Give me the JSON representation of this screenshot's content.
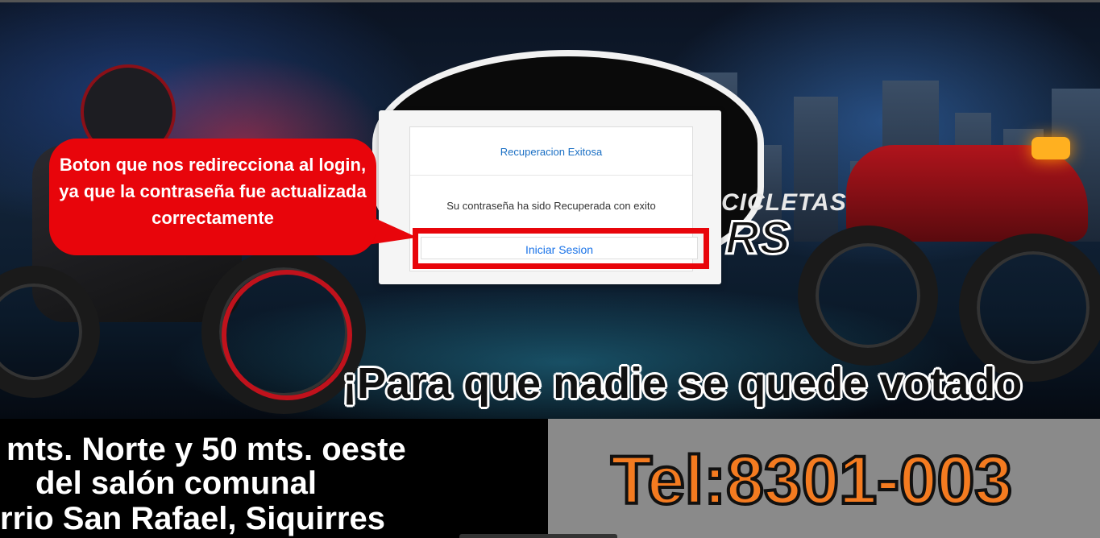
{
  "background": {
    "slogan": "¡Para que nadie se quede votado",
    "brand_partial_1": "CICLETAS",
    "brand_partial_2": "RS",
    "address_lines": [
      "mts. Norte y 50 mts. oeste",
      "del salón comunal",
      "rrio San Rafael, Siquirres"
    ],
    "phone": "Tel:8301-003"
  },
  "modal": {
    "title": "Recuperacion Exitosa",
    "message": "Su contraseña ha sido Recuperada con exito",
    "login_button_label": "Iniciar Sesion"
  },
  "annotation": {
    "callout_text": "Boton que nos redirecciona al login, ya que la contraseña fue actualizada correctamente",
    "highlight_color": "#e8050b"
  },
  "colors": {
    "accent_blue": "#1a73e8",
    "phone_orange": "#f47b20"
  }
}
